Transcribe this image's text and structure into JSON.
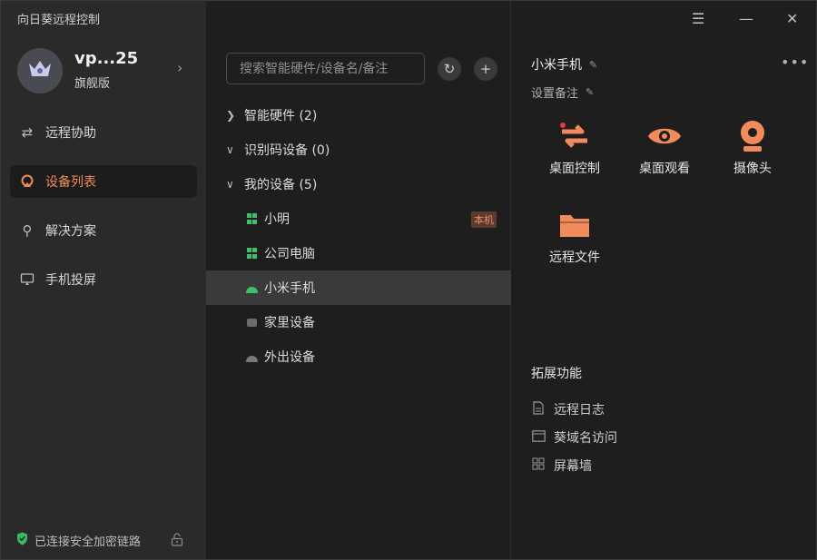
{
  "app": {
    "title": "向日葵远程控制"
  },
  "user": {
    "name": "vp...25",
    "plan": "旗舰版"
  },
  "nav": {
    "items": [
      {
        "label": "远程协助",
        "icon": "remote-assist-icon",
        "active": false
      },
      {
        "label": "设备列表",
        "icon": "device-list-icon",
        "active": true
      },
      {
        "label": "解决方案",
        "icon": "solution-icon",
        "active": false
      },
      {
        "label": "手机投屏",
        "icon": "screen-cast-icon",
        "active": false
      }
    ]
  },
  "status": {
    "text": "已连接安全加密链路",
    "icon": "shield-check-icon"
  },
  "search": {
    "placeholder": "搜索智能硬件/设备名/备注"
  },
  "groups": [
    {
      "label": "智能硬件 (2)",
      "expanded": false
    },
    {
      "label": "识别码设备 (0)",
      "expanded": true
    },
    {
      "label": "我的设备 (5)",
      "expanded": true
    }
  ],
  "devices": [
    {
      "name": "小明",
      "icon": "windows-icon",
      "badge": "本机"
    },
    {
      "name": "公司电脑",
      "icon": "windows-icon"
    },
    {
      "name": "小米手机",
      "icon": "android-icon",
      "selected": true
    },
    {
      "name": "家里设备",
      "icon": "generic-device-icon"
    },
    {
      "name": "外出设备",
      "icon": "android-gray-icon"
    }
  ],
  "detail": {
    "title": "小米手机",
    "note": "设置备注",
    "actions": [
      {
        "label": "桌面控制",
        "icon": "desktop-control-icon"
      },
      {
        "label": "桌面观看",
        "icon": "eye-icon"
      },
      {
        "label": "摄像头",
        "icon": "camera-icon"
      },
      {
        "label": "远程文件",
        "icon": "folder-icon"
      }
    ],
    "ext_title": "拓展功能",
    "ext_items": [
      {
        "label": "远程日志",
        "icon": "document-icon"
      },
      {
        "label": "葵域名访问",
        "icon": "browser-window-icon"
      },
      {
        "label": "屏幕墙",
        "icon": "grid-icon"
      }
    ]
  },
  "colors": {
    "accent": "#f28b5c",
    "sidebar": "#2a2a2a",
    "main": "#1e1e1e",
    "selected_row": "#3a3a3a",
    "green": "#3fbf6b"
  }
}
